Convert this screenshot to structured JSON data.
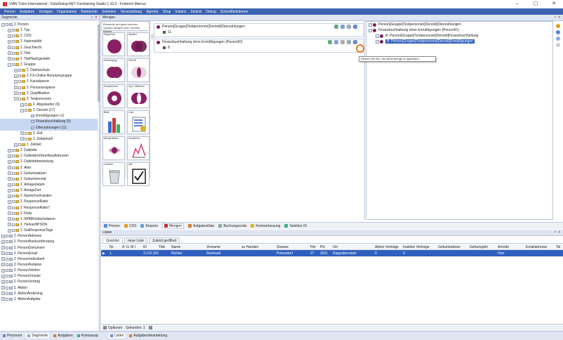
{
  "window": {
    "title": "VIAN Tutori International - DataDialog.NET Fundraising Studio 1.10.0 - Forbeich Marcus",
    "controls": [
      "–",
      "▢",
      "✕"
    ]
  },
  "menu": [
    "Person",
    "Aufgaben",
    "Vorlagen",
    "Organisation",
    "Bankkonto",
    "Selektion",
    "Veranstaltung",
    "Agentur",
    "Shop",
    "Instanz",
    "Zentral",
    "Debug",
    "Schnellfunktionen"
  ],
  "segmente": {
    "title": "Segmente",
    "pin": "ᵖ",
    "close": "✕",
    "tree": [
      {
        "l": 0,
        "t": "−",
        "c": 1,
        "f": "b",
        "s": "Person"
      },
      {
        "l": 1,
        "t": "+",
        "c": 1,
        "f": "y",
        "s": "Typ"
      },
      {
        "l": 1,
        "t": "+",
        "c": 1,
        "f": "y",
        "s": "CDS"
      },
      {
        "l": 1,
        "t": "+",
        "c": 1,
        "f": "y",
        "s": "Nationalität"
      },
      {
        "l": 1,
        "t": "+",
        "c": 1,
        "f": "y",
        "s": "Geschlecht"
      },
      {
        "l": 1,
        "t": "+",
        "c": 1,
        "f": "y",
        "s": "Titel"
      },
      {
        "l": 1,
        "t": "+",
        "c": 1,
        "f": "y",
        "s": "TitelNachgestellt"
      },
      {
        "l": 1,
        "t": "−",
        "c": 1,
        "f": "y",
        "s": "Gruppe"
      },
      {
        "l": 2,
        "t": "+",
        "c": 1,
        "f": "y",
        "s": "Datenschutz"
      },
      {
        "l": 2,
        "t": "+",
        "c": 1,
        "f": "y",
        "s": "FS-Online Benutzergruppe"
      },
      {
        "l": 2,
        "t": "+",
        "c": 1,
        "f": "y",
        "s": "Kanalsperre"
      },
      {
        "l": 2,
        "t": "+",
        "c": 1,
        "f": "y",
        "s": "Personensperre"
      },
      {
        "l": 2,
        "t": "+",
        "c": 1,
        "f": "y",
        "s": "Qualifikation"
      },
      {
        "l": 2,
        "t": "−",
        "c": 1,
        "f": "y",
        "s": "Testpersonen"
      },
      {
        "l": 3,
        "t": "+",
        "c": 1,
        "f": "y",
        "s": "Abgelaufen (9)"
      },
      {
        "l": 3,
        "t": "−",
        "c": 1,
        "f": "y",
        "s": "Derzeit (17)"
      },
      {
        "l": 4,
        "t": "",
        "c": 0,
        "f": "b",
        "s": "Ermäßigungen (1)"
      },
      {
        "l": 4,
        "t": "",
        "c": 0,
        "f": "b",
        "s": "Finanzbuchhaltung (9)",
        "sel": true
      },
      {
        "l": 4,
        "t": "",
        "c": 0,
        "f": "b",
        "s": "Überzahlungen (11)",
        "sel": true
      },
      {
        "l": 3,
        "t": "+",
        "c": 1,
        "f": "y",
        "s": "Zeit"
      },
      {
        "l": 3,
        "t": "+",
        "c": 1,
        "f": "y",
        "s": "Zeitaktuell"
      },
      {
        "l": 2,
        "t": "+",
        "c": 1,
        "f": "y",
        "s": "Zahlart"
      },
      {
        "l": 1,
        "t": "+",
        "c": 1,
        "f": "y",
        "s": "Dublette"
      },
      {
        "l": 1,
        "t": "+",
        "c": 1,
        "f": "y",
        "s": "DublettenOhneNeuAdressen"
      },
      {
        "l": 1,
        "t": "+",
        "c": 1,
        "f": "y",
        "s": "Dublettebewertung"
      },
      {
        "l": 1,
        "t": "+",
        "c": 1,
        "f": "y",
        "s": "Alter"
      },
      {
        "l": 1,
        "t": "+",
        "c": 1,
        "f": "y",
        "s": "Geburtsdatum"
      },
      {
        "l": 1,
        "t": "+",
        "c": 1,
        "f": "y",
        "s": "Geburtsmonat"
      },
      {
        "l": 1,
        "t": "+",
        "c": 1,
        "f": "y",
        "s": "Anlagedatum"
      },
      {
        "l": 1,
        "t": "+",
        "c": 1,
        "f": "y",
        "s": "AnlageZeit"
      },
      {
        "l": 1,
        "t": "+",
        "c": 1,
        "f": "y",
        "s": "Name2vorhanden"
      },
      {
        "l": 1,
        "t": "+",
        "c": 1,
        "f": "y",
        "s": "ResponseRatio"
      },
      {
        "l": 1,
        "t": "+",
        "c": 1,
        "f": "y",
        "s": "ResponseRatio7"
      },
      {
        "l": 1,
        "t": "+",
        "c": 1,
        "f": "y",
        "s": "Notiz"
      },
      {
        "l": 1,
        "t": "+",
        "c": 1,
        "f": "y",
        "s": "SPABGeburtsdatum"
      },
      {
        "l": 1,
        "t": "+",
        "c": 1,
        "f": "y",
        "s": "HerkunftPSON"
      },
      {
        "l": 1,
        "t": "+",
        "c": 1,
        "f": "y",
        "s": "GetResponseTags"
      },
      {
        "l": 0,
        "t": "+",
        "c": 1,
        "f": "b",
        "s": "PersonAdresse"
      },
      {
        "l": 0,
        "t": "+",
        "c": 1,
        "f": "b",
        "s": "PersonBankverbindung"
      },
      {
        "l": 0,
        "t": "+",
        "c": 1,
        "f": "b",
        "s": "PersonDokument"
      },
      {
        "l": 0,
        "t": "+",
        "c": 1,
        "f": "b",
        "s": "PersonEmail"
      },
      {
        "l": 0,
        "t": "+",
        "c": 1,
        "f": "b",
        "s": "PersonIndividuell"
      },
      {
        "l": 0,
        "t": "+",
        "c": 1,
        "f": "b",
        "s": "PersonRelation"
      },
      {
        "l": 0,
        "t": "+",
        "c": 1,
        "f": "b",
        "s": "PersonTelefon"
      },
      {
        "l": 0,
        "t": "+",
        "c": 1,
        "f": "b",
        "s": "PersonUmsatz"
      },
      {
        "l": 0,
        "t": "+",
        "c": 1,
        "f": "b",
        "s": "PersonVertrag"
      },
      {
        "l": 0,
        "t": "+",
        "c": 1,
        "f": "b",
        "s": "Aktion"
      },
      {
        "l": 0,
        "t": "+",
        "c": 1,
        "f": "b",
        "s": "AktionÄnderung"
      },
      {
        "l": 0,
        "t": "+",
        "c": 1,
        "f": "b",
        "s": "AktionAufgabe"
      }
    ]
  },
  "mengen": {
    "title": "Mengen",
    "pin": "ᵖ",
    "close": "✕",
    "palette_hint": "Elemente auf ganz brunnen Symbol ablegen bzw. Symbol klicken",
    "palette": [
      {
        "label": "Segmente",
        "icon": "segment-icon"
      },
      {
        "label": "Spalten",
        "icon": "split-icon"
      },
      {
        "label": "Vereinigung",
        "icon": "union-icon"
      },
      {
        "label": "Schnitt",
        "icon": "intersection-icon"
      },
      {
        "label": "Komplement",
        "icon": "complement-icon"
      },
      {
        "label": "Sym. Differenz",
        "icon": "symdiff-icon"
      },
      {
        "label": "Bilde",
        "icon": "chart-icon"
      },
      {
        "label": "Liste",
        "icon": "list-icon"
      },
      {
        "label": "Mengenlader",
        "icon": "loader-icon"
      },
      {
        "label": "Auswerten",
        "icon": "evaluate-icon"
      },
      {
        "label": "Löschen",
        "icon": "trash-icon"
      },
      {
        "label": "Alle",
        "icon": "check-icon"
      }
    ],
    "cards": [
      {
        "title": "Person[Gruppe[Testpersonen[Derzeit[Überzahlungen",
        "count": "11"
      },
      {
        "title": "Finanzbuchhaltung ohne Ermäßigungen (PersonID)",
        "count": "8"
      }
    ],
    "tooltip": "Klicken Sie hier, um diese Menge zu speichern",
    "formula": [
      {
        "l": 0,
        "t": "Person[Gruppe[Testpersonen[Derzeit[Überzahlungen"
      },
      {
        "l": 0,
        "t": "Finanzbuchhaltung ohne Ermäßigungen (PersonID)"
      },
      {
        "l": 1,
        "t": "A: Person[Gruppe[Testpersonen[Derzeit[Finanzbuchhaltung"
      },
      {
        "l": 1,
        "t": "B: Person[Gruppe[Testpersonen[Derzeit[Ermäßigungen",
        "sel": true
      }
    ]
  },
  "tabs": [
    "Person",
    "CDS",
    "Reports",
    "Mengen",
    "Aufgabenliste",
    "Buchungscode",
    "Kontoerfassung",
    "Selektor ID"
  ],
  "tabs_active": 3,
  "listen": {
    "title": "Listen",
    "pin": "ᵖ",
    "close": "✕",
    "tabs": [
      "Quicklist",
      "neue Liste",
      "Zuletzt geöffnet"
    ],
    "columns": [
      "Nr.",
      "A",
      "G",
      "M I",
      "ID",
      "Titel",
      "Name",
      "Vorname",
      "zu Handen",
      "Strasse",
      "Hnr",
      "Plz",
      "Ort",
      "Aktive Verträge",
      "Inaktive Verträge",
      "Geburtsdatum",
      "Geburtsjahr",
      "Anrede",
      "Emailadresse",
      "Tel"
    ],
    "rows": [
      [
        "1",
        "",
        "",
        "",
        "3.210.201",
        "",
        "Richter",
        "Reinhard",
        "",
        "Pehendorf",
        "27",
        "3911",
        "Rappottenstein",
        "0",
        "0",
        "",
        "",
        "Herr",
        "",
        ""
      ]
    ],
    "footer": {
      "options": "Optionen",
      "found_label": "Gefunden:",
      "found": "1"
    }
  },
  "bottom_left_tabs": [
    "Personen",
    "Segmente",
    "Aufgaben",
    "Kontoausp."
  ],
  "bottom_center_tabs": [
    "Listen",
    "Aufgabenbearbeitung"
  ],
  "colors": {
    "menubar": "#3b63b0",
    "accent": "#7a1f5a",
    "selection": "#2f5fbf"
  }
}
